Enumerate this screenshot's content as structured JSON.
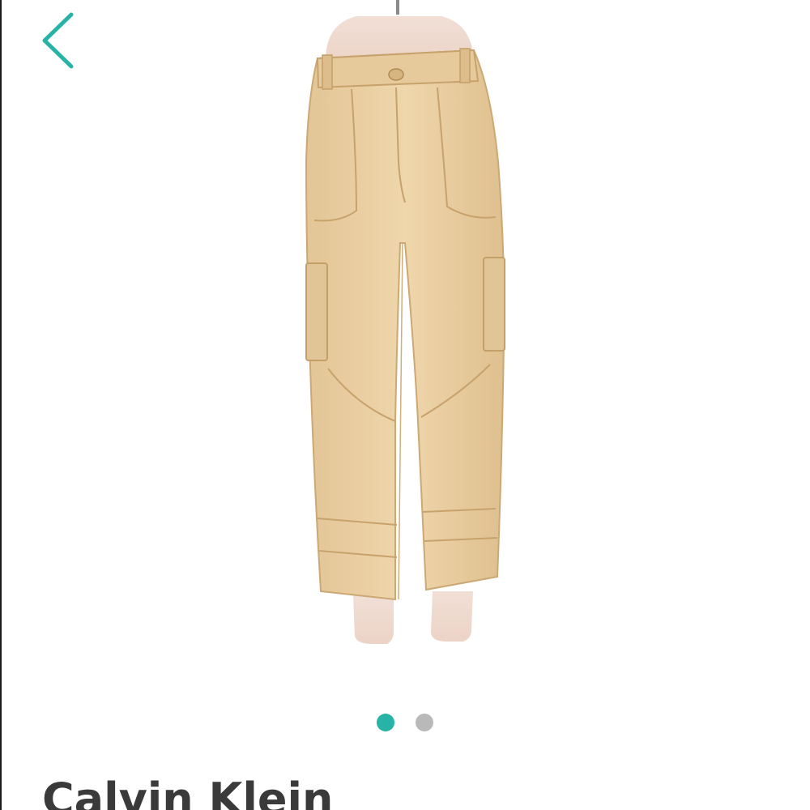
{
  "header": {
    "back_icon": "chevron-left-icon",
    "accent_color": "#27b3a6"
  },
  "gallery": {
    "image_subject": "khaki-cargo-pants-on-mannequin",
    "image_count": 2,
    "active_index": 0,
    "dot_active_color": "#27b3a6",
    "dot_inactive_color": "#b9b9b9"
  },
  "product": {
    "brand": "Calvin Klein"
  }
}
